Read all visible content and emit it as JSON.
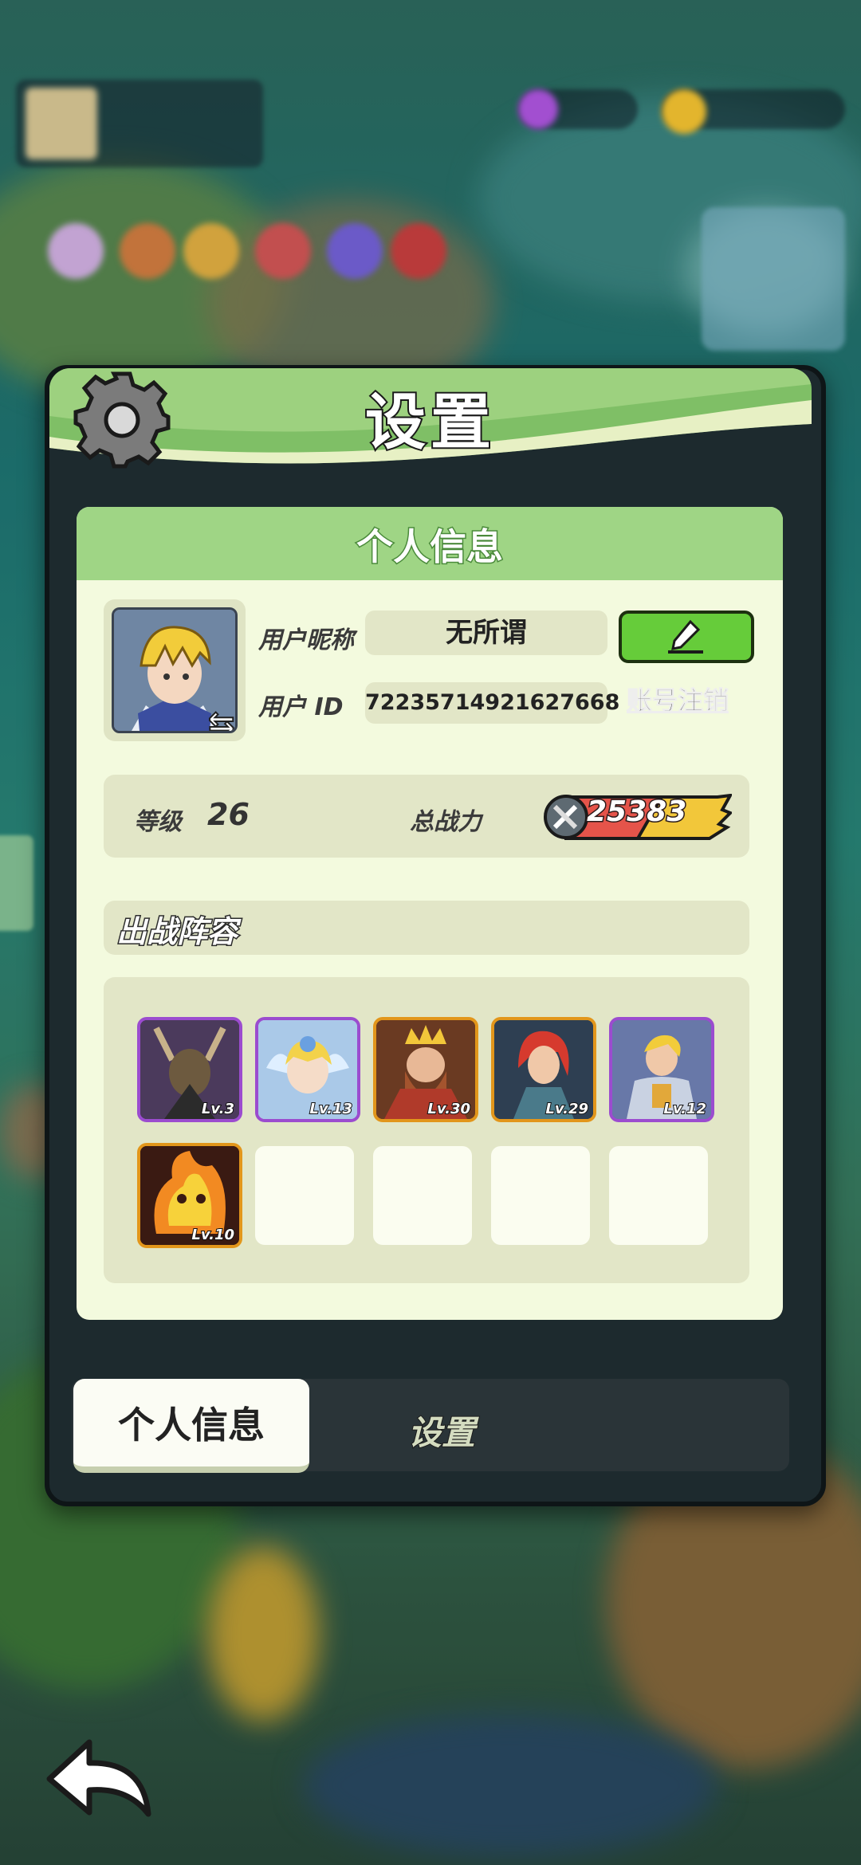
{
  "title": "设置",
  "personal_info": {
    "header": "个人信息",
    "nickname_label": "用户昵称",
    "nickname_value": "无所谓",
    "id_label": "用户 ID",
    "id_value": "72235714921627668",
    "logout_label": "账号注销",
    "level_label": "等级",
    "level_value": "26",
    "power_label": "总战力",
    "power_value": "25383"
  },
  "lineup": {
    "title": "出战阵容",
    "heroes": [
      {
        "level": "Lv.3",
        "rarity": "purple",
        "name": "demon-hero"
      },
      {
        "level": "Lv.13",
        "rarity": "purple",
        "name": "fairy-hero"
      },
      {
        "level": "Lv.30",
        "rarity": "gold",
        "name": "king-hero"
      },
      {
        "level": "Lv.29",
        "rarity": "gold",
        "name": "red-hair-hero"
      },
      {
        "level": "Lv.12",
        "rarity": "purple",
        "name": "knight-hero"
      },
      {
        "level": "Lv.10",
        "rarity": "gold",
        "name": "fire-hero"
      }
    ],
    "empty_slots": 4
  },
  "tabs": {
    "personal": "个人信息",
    "settings": "设置"
  },
  "icons": [
    "gear-icon",
    "edit-pencil-icon",
    "swap-icon",
    "sword-icon",
    "back-arrow-icon"
  ]
}
